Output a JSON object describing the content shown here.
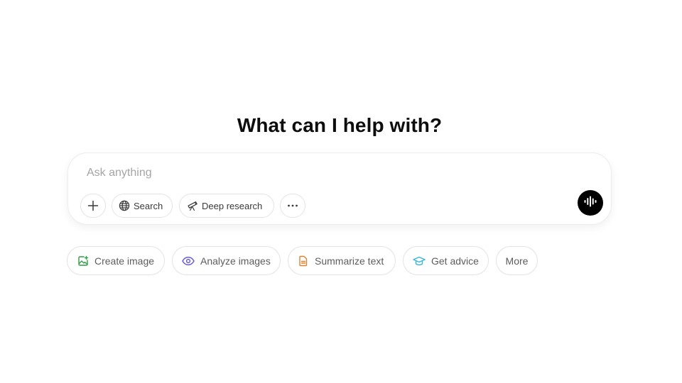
{
  "main": {
    "heading": "What can I help with?"
  },
  "composer": {
    "placeholder": "Ask anything",
    "add_icon": "plus-icon",
    "search_label": "Search",
    "search_icon": "globe-icon",
    "deep_research_label": "Deep research",
    "deep_research_icon": "telescope-icon",
    "more_tools_icon": "ellipsis-icon",
    "voice_icon": "voice-waveform-icon"
  },
  "suggestions": [
    {
      "label": "Create image",
      "icon": "image-icon",
      "color": "#2f9e44"
    },
    {
      "label": "Analyze images",
      "icon": "eye-icon",
      "color": "#6b5fd6"
    },
    {
      "label": "Summarize text",
      "icon": "document-icon",
      "color": "#e0822b"
    },
    {
      "label": "Get advice",
      "icon": "graduation-cap-icon",
      "color": "#38b4d8"
    },
    {
      "label": "More",
      "icon": "",
      "color": ""
    }
  ],
  "colors": {
    "accent": "#000000",
    "border": "#e3e3e3",
    "placeholder": "#a5a5a5"
  }
}
